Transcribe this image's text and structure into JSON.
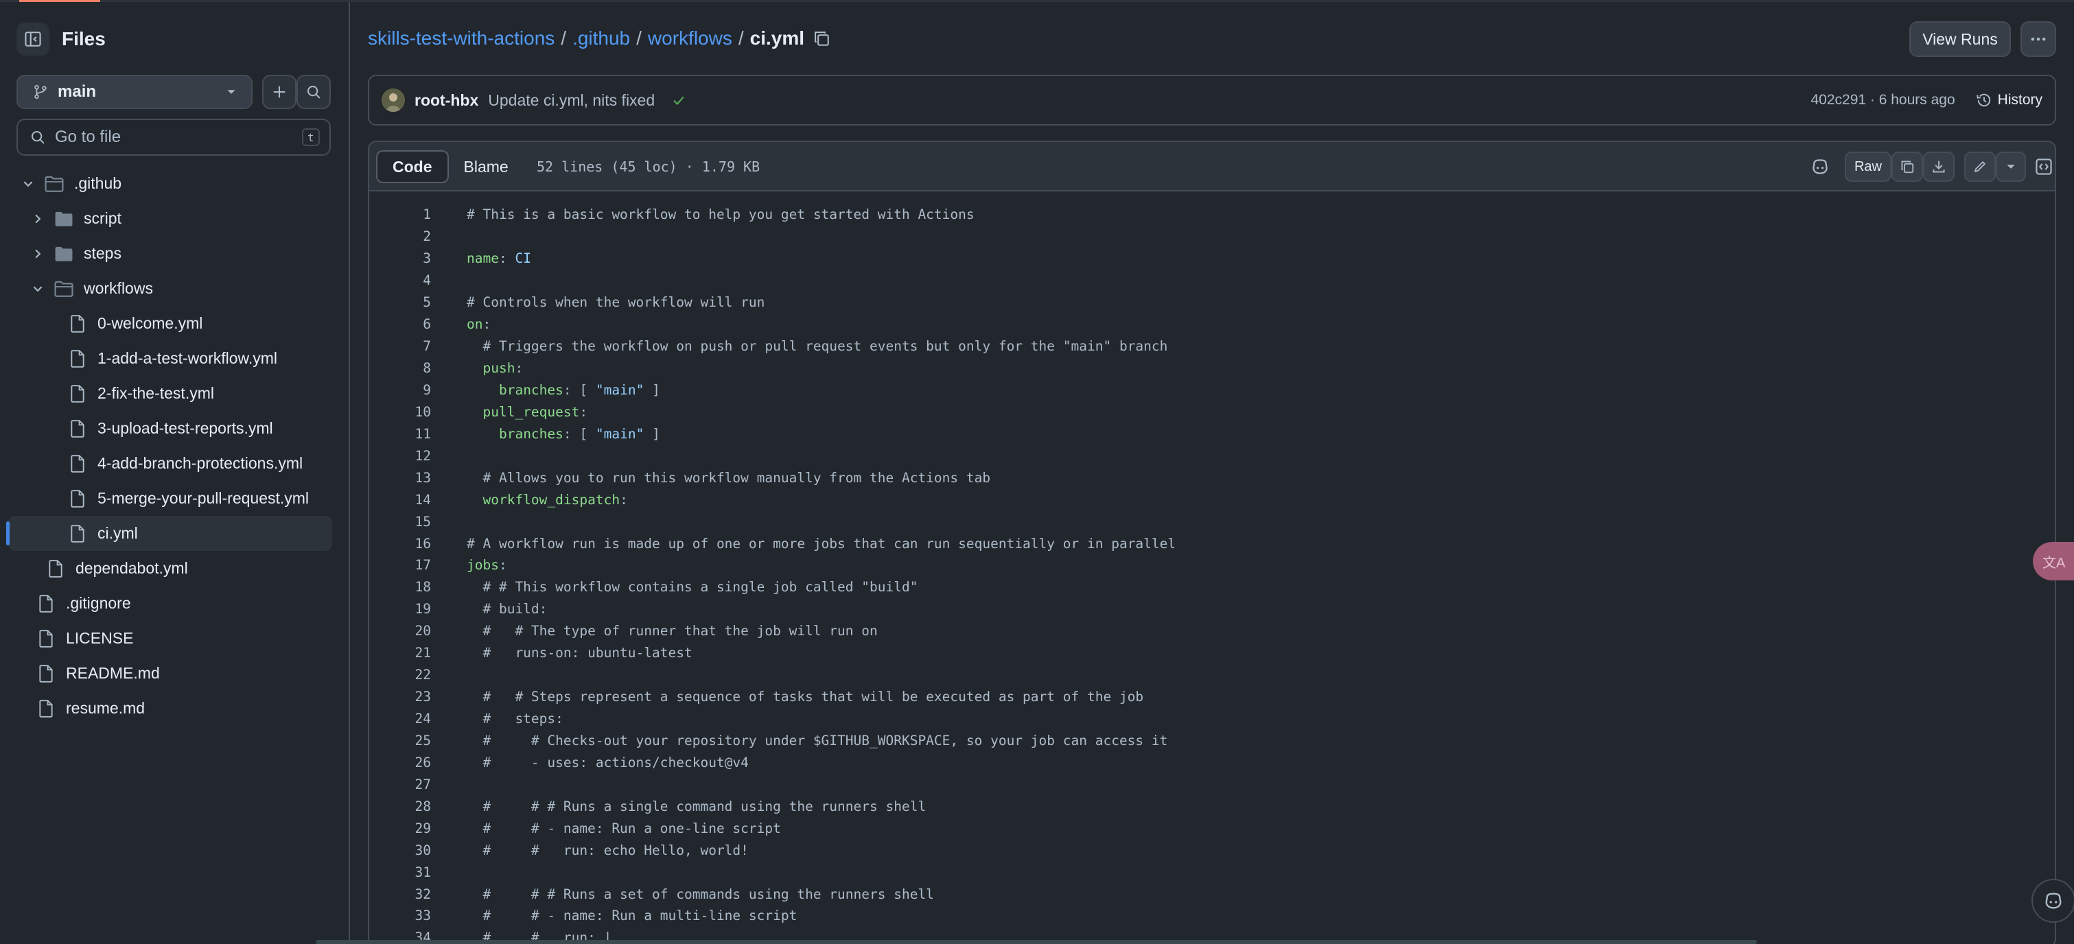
{
  "sidebar": {
    "title": "Files",
    "branch": "main",
    "goto_placeholder": "Go to file",
    "goto_shortcut": "t",
    "tree": [
      {
        "label": ".github",
        "type": "folder",
        "depth": 0,
        "expanded": true
      },
      {
        "label": "script",
        "type": "folder",
        "depth": 1,
        "expanded": false
      },
      {
        "label": "steps",
        "type": "folder",
        "depth": 1,
        "expanded": false
      },
      {
        "label": "workflows",
        "type": "folder",
        "depth": 1,
        "expanded": true
      },
      {
        "label": "0-welcome.yml",
        "type": "file",
        "depth": 2
      },
      {
        "label": "1-add-a-test-workflow.yml",
        "type": "file",
        "depth": 2
      },
      {
        "label": "2-fix-the-test.yml",
        "type": "file",
        "depth": 2
      },
      {
        "label": "3-upload-test-reports.yml",
        "type": "file",
        "depth": 2
      },
      {
        "label": "4-add-branch-protections.yml",
        "type": "file",
        "depth": 2
      },
      {
        "label": "5-merge-your-pull-request.yml",
        "type": "file",
        "depth": 2
      },
      {
        "label": "ci.yml",
        "type": "file",
        "depth": 2,
        "selected": true
      },
      {
        "label": "dependabot.yml",
        "type": "file",
        "depth": 1
      },
      {
        "label": ".gitignore",
        "type": "file",
        "depth": 0
      },
      {
        "label": "LICENSE",
        "type": "file",
        "depth": 0
      },
      {
        "label": "README.md",
        "type": "file",
        "depth": 0
      },
      {
        "label": "resume.md",
        "type": "file",
        "depth": 0
      }
    ]
  },
  "breadcrumb": {
    "repo": "skills-test-with-actions",
    "dir1": ".github",
    "dir2": "workflows",
    "file": "ci.yml",
    "sep": "/"
  },
  "header": {
    "view_runs_label": "View Runs"
  },
  "commit": {
    "author": "root-hbx",
    "message": "Update ci.yml, nits fixed",
    "meta": "402c291 · 6 hours ago",
    "history_label": "History"
  },
  "code_view": {
    "tab_code": "Code",
    "tab_blame": "Blame",
    "info": "52 lines (45 loc) · 1.79 KB",
    "raw_label": "Raw"
  },
  "translate_label": "文A",
  "colors": {
    "background": "#22272e",
    "link": "#539bf5",
    "border": "#444c56",
    "success": "#57ab5a",
    "selection_bar": "#4184e4"
  },
  "code_lines": [
    "# This is a basic workflow to help you get started with Actions",
    "",
    "name: CI",
    "",
    "# Controls when the workflow will run",
    "on:",
    "  # Triggers the workflow on push or pull request events but only for the \"main\" branch",
    "  push:",
    "    branches: [ \"main\" ]",
    "  pull_request:",
    "    branches: [ \"main\" ]",
    "",
    "  # Allows you to run this workflow manually from the Actions tab",
    "  workflow_dispatch:",
    "",
    "# A workflow run is made up of one or more jobs that can run sequentially or in parallel",
    "jobs:",
    "  # # This workflow contains a single job called \"build\"",
    "  # build:",
    "  #   # The type of runner that the job will run on",
    "  #   runs-on: ubuntu-latest",
    "",
    "  #   # Steps represent a sequence of tasks that will be executed as part of the job",
    "  #   steps:",
    "  #     # Checks-out your repository under $GITHUB_WORKSPACE, so your job can access it",
    "  #     - uses: actions/checkout@v4",
    "",
    "  #     # # Runs a single command using the runners shell",
    "  #     # - name: Run a one-line script",
    "  #     #   run: echo Hello, world!",
    "",
    "  #     # # Runs a set of commands using the runners shell",
    "  #     # - name: Run a multi-line script",
    "  #     #   run: |"
  ]
}
